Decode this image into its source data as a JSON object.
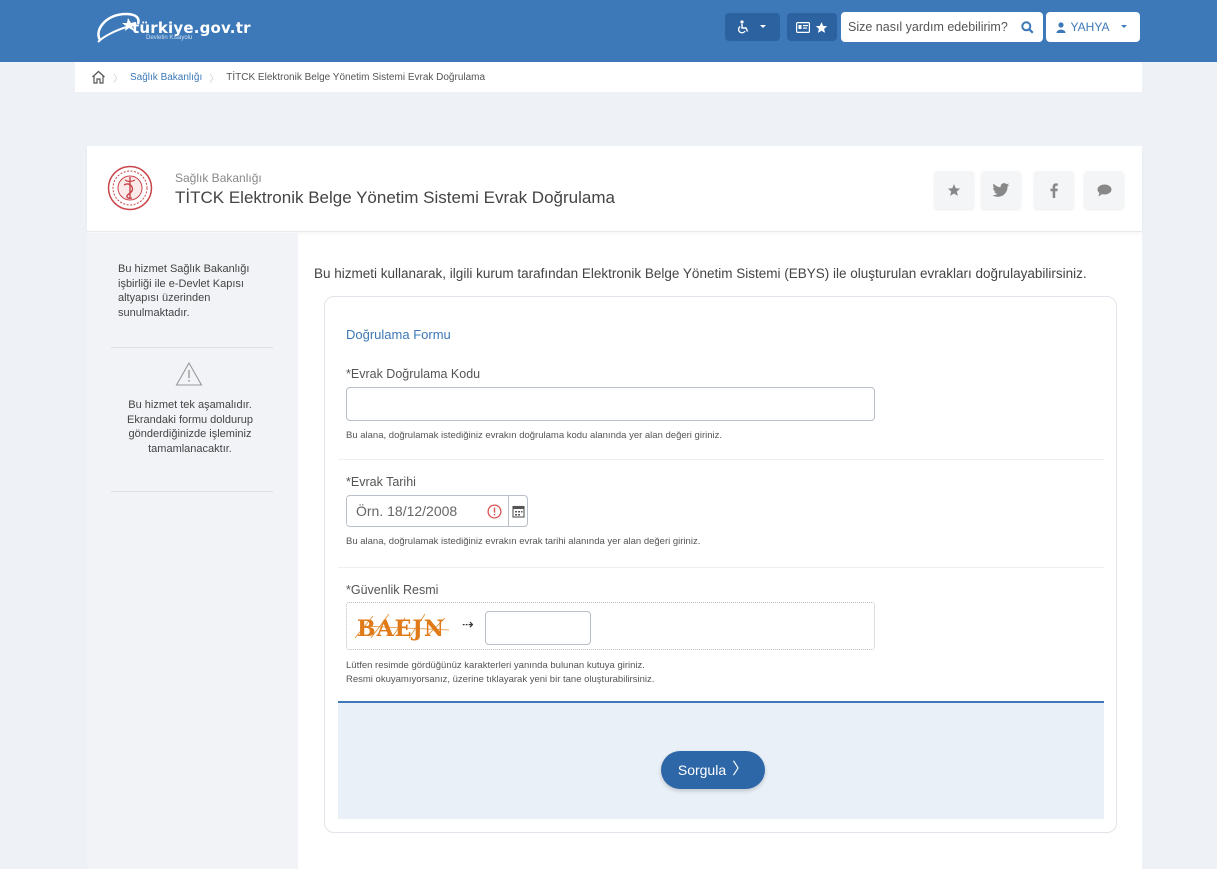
{
  "header": {
    "logo_text": "türkiye.gov.tr",
    "logo_sub": "Devletin Kısayolu",
    "search_placeholder": "Size nasıl yardım edebilirim?",
    "user_name": "YAHYA",
    "accessibility_icon": "wheelchair-icon",
    "favorites_icon": "star-icon"
  },
  "breadcrumb": {
    "items": [
      "Sağlık Bakanlığı",
      "TİTCK Elektronik Belge Yönetim Sistemi Evrak Doğrulama"
    ]
  },
  "service": {
    "institution": "Sağlık Bakanlığı",
    "title": "TİTCK Elektronik Belge Yönetim Sistemi Evrak Doğrulama",
    "share_icons": [
      "star-icon",
      "twitter-icon",
      "facebook-icon",
      "comment-icon"
    ]
  },
  "sidebar": {
    "info": "Bu hizmet Sağlık Bakanlığı işbirliği ile e-Devlet Kapısı altyapısı üzerinden sunulmaktadır.",
    "notice": "Bu hizmet tek aşamalıdır. Ekrandaki formu doldurup gönderdiğinizde işleminiz tamamlanacaktır."
  },
  "content": {
    "intro": "Bu hizmeti kullanarak, ilgili kurum tarafından Elektronik Belge Yönetim Sistemi (EBYS) ile oluşturulan evrakları doğrulayabilirsiniz.",
    "form_title": "Doğrulama Formu",
    "code": {
      "label": "*Evrak Doğrulama Kodu",
      "value": "",
      "help": "Bu alana, doğrulamak istediğiniz evrakın doğrulama kodu alanında yer alan değeri giriniz."
    },
    "date": {
      "label": "*Evrak Tarihi",
      "placeholder": "Örn. 18/12/2008",
      "help": "Bu alana, doğrulamak istediğiniz evrakın evrak tarihi alanında yer alan değeri giriniz."
    },
    "captcha": {
      "label": "*Güvenlik Resmi",
      "image_text": "BAEJN",
      "help1": "Lütfen resimde gördüğünüz karakterleri yanında bulunan kutuya giriniz.",
      "help2": "Resmi okuyamıyorsanız, üzerine tıklayarak yeni bir tane oluşturabilirsiniz."
    },
    "submit_label": "Sorgula",
    "colors": {
      "brand": "#3d79b8",
      "button": "#2d67a8",
      "error": "#d9534f"
    }
  }
}
